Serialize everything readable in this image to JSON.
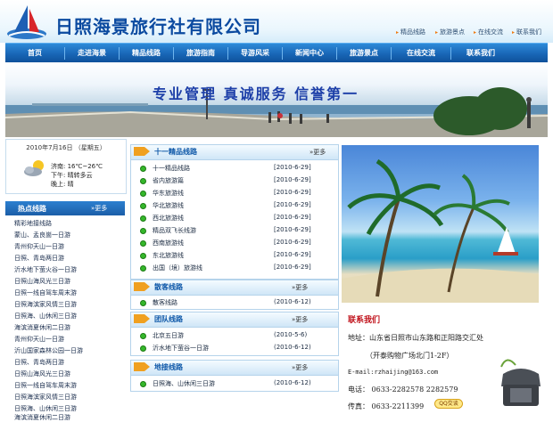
{
  "header": {
    "site_name": "日照海景旅行社有限公司",
    "top_links": [
      "精品线路",
      "旅游景点",
      "在线交流",
      "联系我们"
    ]
  },
  "nav": [
    "首页",
    "走进海景",
    "精品线路",
    "旅游指南",
    "导游风采",
    "新闻中心",
    "旅游景点",
    "在线交流",
    "联系我们"
  ],
  "banner": {
    "slogan": "专业管理  真诚服务  信誉第一"
  },
  "datebox": {
    "date": "2010年7月16日 （星期五）",
    "city": "济南: 16℃~26℃",
    "afternoon": "下午: 晴转多云",
    "evening": "晚上: 晴"
  },
  "hot_routes": {
    "title": "热点线路",
    "more": "更多",
    "items": [
      "精彩地接线路",
      "蒙山、孟良崮一日游",
      "青州仰天山一日游",
      "日照、青岛两日游",
      "沂水地下萤火谷一日游",
      "日照山海风光三日游",
      "日照一线自驾车周末游",
      "日照海滨家风情三日游",
      "日照海、山休闲三日游",
      "海滨消夏休闲二日游",
      "青州仰天山一日游",
      "沂山国家森林公园一日游",
      "日照、青岛两日游",
      "日照山海风光三日游",
      "日照一线自驾车周末游",
      "日照海滨家风情三日游",
      "日照海、山休闲三日游",
      "海滨消夏休闲二日游"
    ]
  },
  "sections": {
    "top10": {
      "title": "十一精品线路",
      "more": "更多",
      "rows": [
        {
          "name": "十一精品线路",
          "date": "[2010-6-29]"
        },
        {
          "name": "省内旅游篇",
          "date": "[2010-6-29]"
        },
        {
          "name": "华东旅游线",
          "date": "[2010-6-29]"
        },
        {
          "name": "华北旅游线",
          "date": "[2010-6-29]"
        },
        {
          "name": "西北旅游线",
          "date": "[2010-6-29]"
        },
        {
          "name": "精品双飞长线游",
          "date": "[2010-6-29]"
        },
        {
          "name": "西南旅游线",
          "date": "[2010-6-29]"
        },
        {
          "name": "东北旅游线",
          "date": "[2010-6-29]"
        },
        {
          "name": "出国（境）旅游线",
          "date": "[2010-6-29]"
        }
      ]
    },
    "individual": {
      "title": "散客线路",
      "more": "更多",
      "rows": [
        {
          "name": "散客线路",
          "date": "(2010-6-12)"
        }
      ]
    },
    "group": {
      "title": "团队线路",
      "more": "更多",
      "rows": [
        {
          "name": "北京五日游",
          "date": "(2010-5-6)"
        },
        {
          "name": "沂水地下萤谷一日游",
          "date": "(2010-6-12)"
        }
      ]
    },
    "local": {
      "title": "地接线路",
      "more": "更多",
      "rows": [
        {
          "name": "日照海、山休闲三日游",
          "date": "(2010-6-12)"
        }
      ]
    }
  },
  "contact": {
    "title": "联系我们",
    "address": "地址：山东省日照市山东路和正阳路交汇处",
    "address2": "（开泰购物广场北门1-2F）",
    "email": "E-mail:rzhaijing@163.com",
    "tel": "电话： 0633-2282578  2282579",
    "fax": "传真： 0633-2211399",
    "qq_label": "QQ交谈"
  },
  "colors": {
    "brand_blue": "#1865b5",
    "title_red": "#c0111a",
    "bullet_green": "#35b72b"
  }
}
